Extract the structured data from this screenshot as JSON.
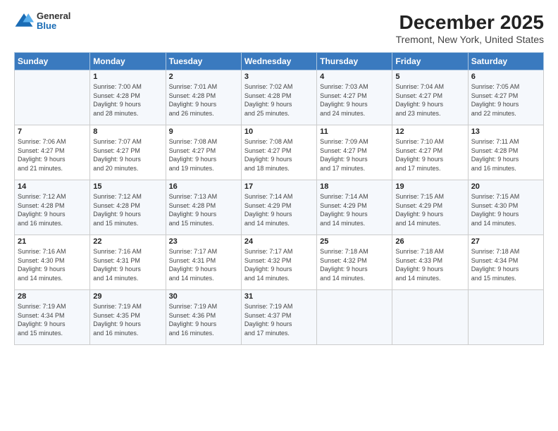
{
  "logo": {
    "general": "General",
    "blue": "Blue"
  },
  "title": "December 2025",
  "subtitle": "Tremont, New York, United States",
  "days_of_week": [
    "Sunday",
    "Monday",
    "Tuesday",
    "Wednesday",
    "Thursday",
    "Friday",
    "Saturday"
  ],
  "weeks": [
    [
      {
        "day": "",
        "info": ""
      },
      {
        "day": "1",
        "info": "Sunrise: 7:00 AM\nSunset: 4:28 PM\nDaylight: 9 hours\nand 28 minutes."
      },
      {
        "day": "2",
        "info": "Sunrise: 7:01 AM\nSunset: 4:28 PM\nDaylight: 9 hours\nand 26 minutes."
      },
      {
        "day": "3",
        "info": "Sunrise: 7:02 AM\nSunset: 4:28 PM\nDaylight: 9 hours\nand 25 minutes."
      },
      {
        "day": "4",
        "info": "Sunrise: 7:03 AM\nSunset: 4:27 PM\nDaylight: 9 hours\nand 24 minutes."
      },
      {
        "day": "5",
        "info": "Sunrise: 7:04 AM\nSunset: 4:27 PM\nDaylight: 9 hours\nand 23 minutes."
      },
      {
        "day": "6",
        "info": "Sunrise: 7:05 AM\nSunset: 4:27 PM\nDaylight: 9 hours\nand 22 minutes."
      }
    ],
    [
      {
        "day": "7",
        "info": "Sunrise: 7:06 AM\nSunset: 4:27 PM\nDaylight: 9 hours\nand 21 minutes."
      },
      {
        "day": "8",
        "info": "Sunrise: 7:07 AM\nSunset: 4:27 PM\nDaylight: 9 hours\nand 20 minutes."
      },
      {
        "day": "9",
        "info": "Sunrise: 7:08 AM\nSunset: 4:27 PM\nDaylight: 9 hours\nand 19 minutes."
      },
      {
        "day": "10",
        "info": "Sunrise: 7:08 AM\nSunset: 4:27 PM\nDaylight: 9 hours\nand 18 minutes."
      },
      {
        "day": "11",
        "info": "Sunrise: 7:09 AM\nSunset: 4:27 PM\nDaylight: 9 hours\nand 17 minutes."
      },
      {
        "day": "12",
        "info": "Sunrise: 7:10 AM\nSunset: 4:27 PM\nDaylight: 9 hours\nand 17 minutes."
      },
      {
        "day": "13",
        "info": "Sunrise: 7:11 AM\nSunset: 4:28 PM\nDaylight: 9 hours\nand 16 minutes."
      }
    ],
    [
      {
        "day": "14",
        "info": "Sunrise: 7:12 AM\nSunset: 4:28 PM\nDaylight: 9 hours\nand 16 minutes."
      },
      {
        "day": "15",
        "info": "Sunrise: 7:12 AM\nSunset: 4:28 PM\nDaylight: 9 hours\nand 15 minutes."
      },
      {
        "day": "16",
        "info": "Sunrise: 7:13 AM\nSunset: 4:28 PM\nDaylight: 9 hours\nand 15 minutes."
      },
      {
        "day": "17",
        "info": "Sunrise: 7:14 AM\nSunset: 4:29 PM\nDaylight: 9 hours\nand 14 minutes."
      },
      {
        "day": "18",
        "info": "Sunrise: 7:14 AM\nSunset: 4:29 PM\nDaylight: 9 hours\nand 14 minutes."
      },
      {
        "day": "19",
        "info": "Sunrise: 7:15 AM\nSunset: 4:29 PM\nDaylight: 9 hours\nand 14 minutes."
      },
      {
        "day": "20",
        "info": "Sunrise: 7:15 AM\nSunset: 4:30 PM\nDaylight: 9 hours\nand 14 minutes."
      }
    ],
    [
      {
        "day": "21",
        "info": "Sunrise: 7:16 AM\nSunset: 4:30 PM\nDaylight: 9 hours\nand 14 minutes."
      },
      {
        "day": "22",
        "info": "Sunrise: 7:16 AM\nSunset: 4:31 PM\nDaylight: 9 hours\nand 14 minutes."
      },
      {
        "day": "23",
        "info": "Sunrise: 7:17 AM\nSunset: 4:31 PM\nDaylight: 9 hours\nand 14 minutes."
      },
      {
        "day": "24",
        "info": "Sunrise: 7:17 AM\nSunset: 4:32 PM\nDaylight: 9 hours\nand 14 minutes."
      },
      {
        "day": "25",
        "info": "Sunrise: 7:18 AM\nSunset: 4:32 PM\nDaylight: 9 hours\nand 14 minutes."
      },
      {
        "day": "26",
        "info": "Sunrise: 7:18 AM\nSunset: 4:33 PM\nDaylight: 9 hours\nand 14 minutes."
      },
      {
        "day": "27",
        "info": "Sunrise: 7:18 AM\nSunset: 4:34 PM\nDaylight: 9 hours\nand 15 minutes."
      }
    ],
    [
      {
        "day": "28",
        "info": "Sunrise: 7:19 AM\nSunset: 4:34 PM\nDaylight: 9 hours\nand 15 minutes."
      },
      {
        "day": "29",
        "info": "Sunrise: 7:19 AM\nSunset: 4:35 PM\nDaylight: 9 hours\nand 16 minutes."
      },
      {
        "day": "30",
        "info": "Sunrise: 7:19 AM\nSunset: 4:36 PM\nDaylight: 9 hours\nand 16 minutes."
      },
      {
        "day": "31",
        "info": "Sunrise: 7:19 AM\nSunset: 4:37 PM\nDaylight: 9 hours\nand 17 minutes."
      },
      {
        "day": "",
        "info": ""
      },
      {
        "day": "",
        "info": ""
      },
      {
        "day": "",
        "info": ""
      }
    ]
  ]
}
